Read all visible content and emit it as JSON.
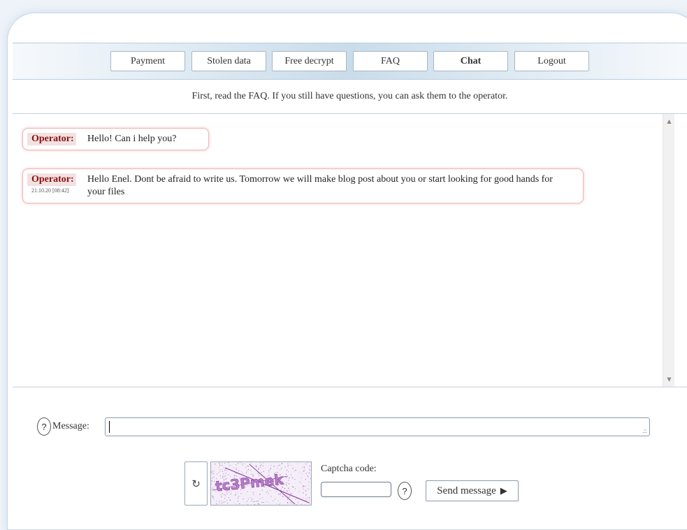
{
  "nav": {
    "items": [
      {
        "label": "Payment"
      },
      {
        "label": "Stolen data"
      },
      {
        "label": "Free decrypt"
      },
      {
        "label": "FAQ"
      },
      {
        "label": "Chat",
        "active": true
      },
      {
        "label": "Logout"
      }
    ]
  },
  "notice": "First, read the FAQ. If you still have questions, you can ask them to the operator.",
  "chat": {
    "messages": [
      {
        "author": "Operator:",
        "time": "",
        "text": "Hello! Can i help you?"
      },
      {
        "author": "Operator:",
        "time": "21.10.20 [08:42]",
        "text": "Hello Enel. Dont be afraid to write us. Tomorrow we will make blog post about you or start looking for good hands for your files"
      }
    ]
  },
  "form": {
    "help_glyph": "?",
    "message_label": "Message:",
    "message_value": "",
    "resize_grip": ".::",
    "refresh_glyph": "↻",
    "captcha_text": "tc3Pmek",
    "captcha_label": "Captcha code:",
    "captcha_value": "",
    "send_label": "Send message",
    "send_icon": "▶"
  },
  "scrollbar": {
    "up": "▲",
    "down": "▼"
  },
  "colors": {
    "operator_name": "#8b1010",
    "message_border": "#f0b6b6",
    "nav_gradient_center": "#c9dcea",
    "captcha_ink": "#8a3fa0"
  }
}
